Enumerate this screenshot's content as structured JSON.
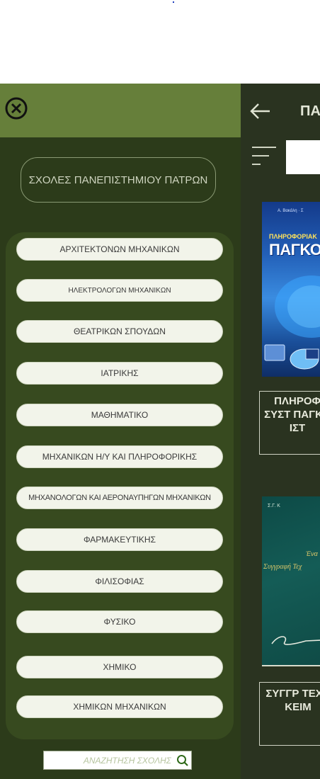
{
  "main": {
    "title": "ΠΑ",
    "search": {
      "placeholder": "",
      "value": ""
    },
    "books": [
      {
        "cover_lines": [
          "ΠΛΗΡΟΦΟΡΙΑΚ",
          "ΠΑΓΚΟΣΜ"
        ],
        "title": "ΠΛΗΡΟΦ ΣΥΣΤ ΠΑΓΚΟ ΙΣΤ"
      },
      {
        "cover_lines": [
          "Σ.Γ. Κ",
          "Ένα",
          "Συγγραφή Τεχ"
        ],
        "title": "ΣΥΓΓΡ ΤΕΧΝ ΚΕΙΜ"
      }
    ]
  },
  "drawer": {
    "heading": "ΣΧΟΛΕΣ ΠΑΝΕΠΙΣΤΗΜΙΟΥ ΠΑΤΡΩΝ",
    "schools": [
      "ΑΡΧΙΤΕΚΤΟΝΩΝ ΜΗΧΑΝΙΚΩΝ",
      "ΗΛΕΚΤΡΟΛΟΓΩΝ ΜΗΧΑΝΙΚΩΝ",
      "ΘΕΑΤΡΙΚΩΝ ΣΠΟΥΔΩΝ",
      "ΙΑΤΡΙΚΗΣ",
      "ΜΑΘΗΜΑΤΙΚΟ",
      "ΜΗΧΑΝΙΚΩΝ Η/Υ ΚΑΙ ΠΛΗΡΟΦΟΡΙΚΗΣ",
      "ΜΗΧΑΝΟΛΟΓΩΝ ΚΑΙ ΑΕΡΟΝΑΥΠΗΓΩΝ ΜΗΧΑΝΙΚΩΝ",
      "ΦΑΡΜΑΚΕΥΤΙΚΗΣ",
      "ΦΙΛΙΣΟΦΙΑΣ",
      "ΦΥΣΙΚΟ",
      "ΧΗΜΙΚΟ",
      "ΧΗΜΙΚΩΝ ΜΗΧΑΝΙΚΩΝ"
    ],
    "search_placeholder": "ΑΝΑΖΗΤΗΣΗ ΣΧΟΛΗΣ"
  },
  "icons": {
    "close": "close-circle-icon",
    "back": "arrow-left-icon",
    "menu": "filter-lines-icon",
    "search": "search-icon"
  },
  "colors": {
    "drawer_header": "#667f3a",
    "drawer_bg": "#2c3b1a",
    "list_panel": "#374a1f",
    "main_bg": "#2a3320",
    "button_bg": "#f2f4ea"
  }
}
